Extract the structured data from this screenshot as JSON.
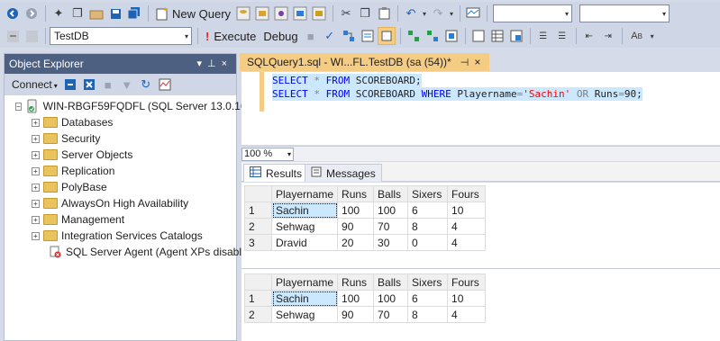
{
  "toolbar1": {
    "new_query_label": "New Query"
  },
  "toolbar2": {
    "database": "TestDB",
    "execute_label": "Execute",
    "debug_label": "Debug"
  },
  "object_explorer": {
    "title": "Object Explorer",
    "connect_label": "Connect",
    "server": "WIN-RBGF59FQDFL (SQL Server 13.0.16",
    "items": [
      {
        "label": "Databases"
      },
      {
        "label": "Security"
      },
      {
        "label": "Server Objects"
      },
      {
        "label": "Replication"
      },
      {
        "label": "PolyBase"
      },
      {
        "label": "AlwaysOn High Availability"
      },
      {
        "label": "Management"
      },
      {
        "label": "Integration Services Catalogs"
      }
    ],
    "agent_label": "SQL Server Agent (Agent XPs disabl"
  },
  "editor": {
    "tab_title": "SQLQuery1.sql - WI...FL.TestDB (sa (54))*",
    "line1": {
      "kw1": "SELECT",
      "star": "*",
      "kw2": "FROM",
      "rest": "SCOREBOARD;"
    },
    "line2": {
      "kw1": "SELECT",
      "star": "*",
      "kw2": "FROM",
      "table": "SCOREBOARD",
      "kw3": "WHERE",
      "col": "Playername",
      "eq": "=",
      "str": "'Sachin'",
      "kw4": "OR",
      "col2": "Runs",
      "eq2": "=",
      "num": "90;"
    },
    "zoom": "100 %"
  },
  "results": {
    "tab_results": "Results",
    "tab_messages": "Messages",
    "columns": [
      "Playername",
      "Runs",
      "Balls",
      "Sixers",
      "Fours"
    ],
    "grid1": [
      {
        "n": "1",
        "cells": [
          "Sachin",
          "100",
          "100",
          "6",
          "10"
        ]
      },
      {
        "n": "2",
        "cells": [
          "Sehwag",
          "90",
          "70",
          "8",
          "4"
        ]
      },
      {
        "n": "3",
        "cells": [
          "Dravid",
          "20",
          "30",
          "0",
          "4"
        ]
      }
    ],
    "grid2": [
      {
        "n": "1",
        "cells": [
          "Sachin",
          "100",
          "100",
          "6",
          "10"
        ]
      },
      {
        "n": "2",
        "cells": [
          "Sehwag",
          "90",
          "70",
          "8",
          "4"
        ]
      }
    ]
  }
}
